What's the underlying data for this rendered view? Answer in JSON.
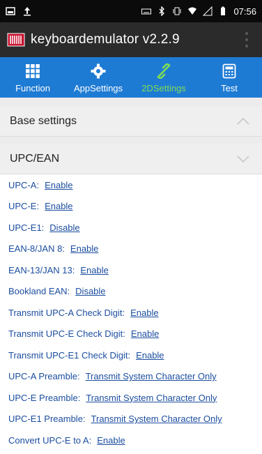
{
  "status_bar": {
    "time": "07:56"
  },
  "app_bar": {
    "title": "keyboardemulator v2.2.9"
  },
  "tabs": [
    {
      "label": "Function",
      "icon": "grid-icon"
    },
    {
      "label": "AppSettings",
      "icon": "gear-icon"
    },
    {
      "label": "2DSettings",
      "icon": "link-icon",
      "active": true
    },
    {
      "label": "Test",
      "icon": "calculator-icon"
    }
  ],
  "sections": {
    "base": "Base settings",
    "upc": "UPC/EAN"
  },
  "settings": [
    {
      "label": "UPC-A:",
      "value": "Enable"
    },
    {
      "label": "UPC-E:",
      "value": "Enable"
    },
    {
      "label": "UPC-E1:",
      "value": "Disable"
    },
    {
      "label": "EAN-8/JAN 8:",
      "value": "Enable"
    },
    {
      "label": "EAN-13/JAN 13:",
      "value": "Enable"
    },
    {
      "label": "Bookland EAN:",
      "value": "Disable"
    },
    {
      "label": "Transmit UPC-A Check Digit:",
      "value": "Enable"
    },
    {
      "label": "Transmit UPC-E Check Digit:",
      "value": "Enable"
    },
    {
      "label": "Transmit UPC-E1 Check Digit:",
      "value": "Enable"
    },
    {
      "label": "UPC-A Preamble:",
      "value": "Transmit System Character Only"
    },
    {
      "label": "UPC-E Preamble:",
      "value": "Transmit System Character Only"
    },
    {
      "label": "UPC-E1 Preamble:",
      "value": "Transmit System Character Only"
    },
    {
      "label": "Convert UPC-E to A:",
      "value": "Enable"
    }
  ],
  "colors": {
    "tab_bg": "#1e7bd4",
    "active_tab": "#7fdc55",
    "link": "#1b4d9e"
  }
}
